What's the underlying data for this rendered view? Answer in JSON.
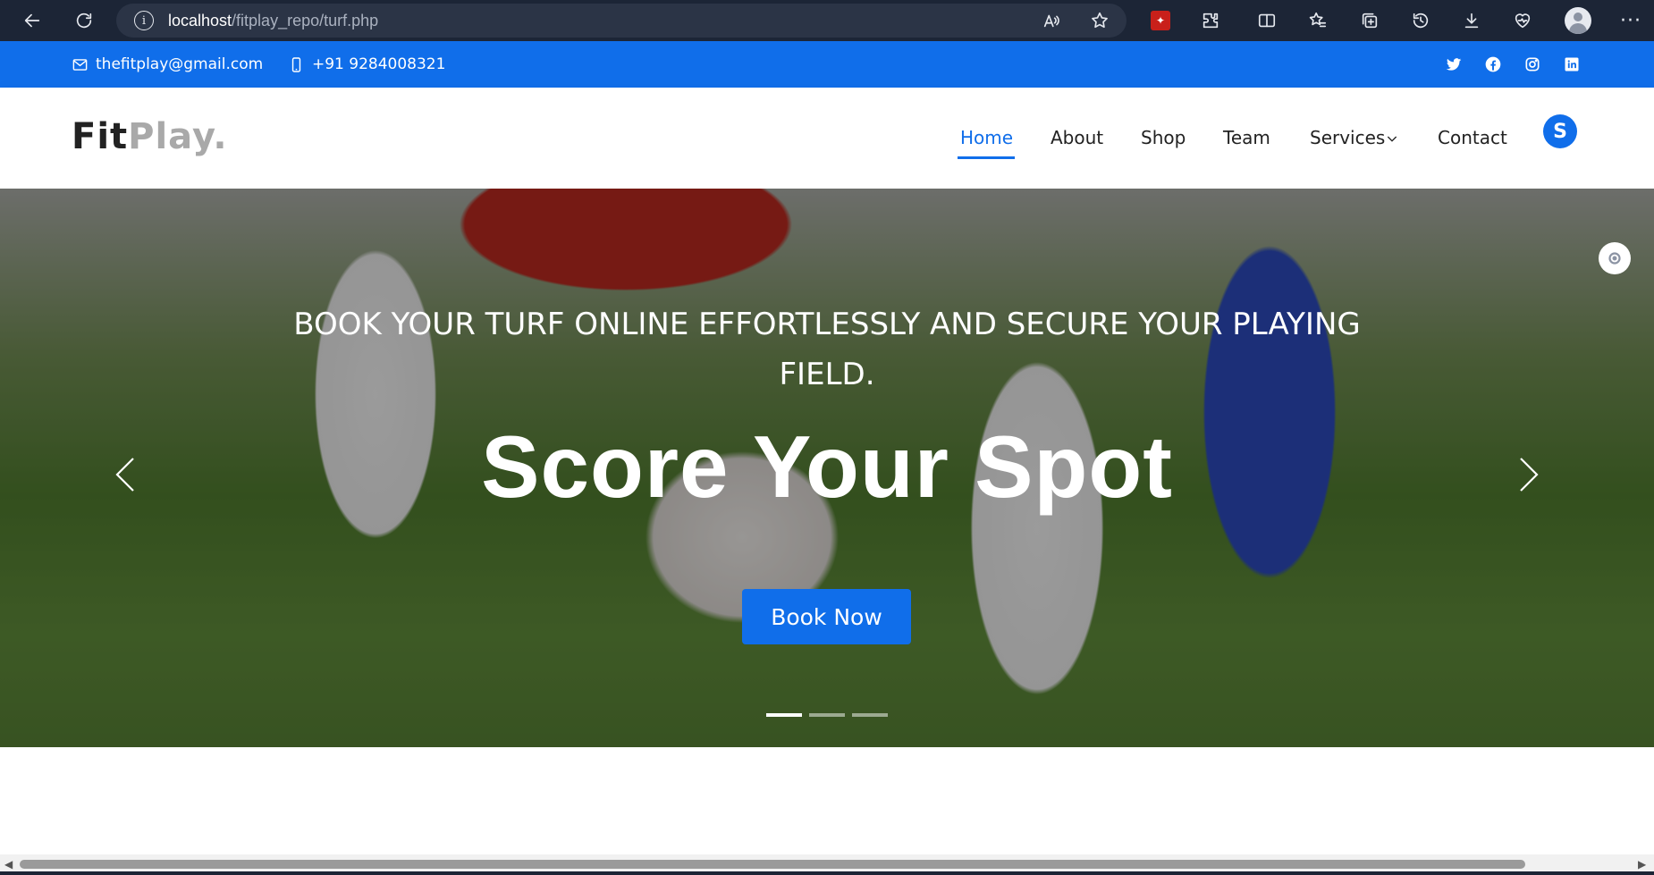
{
  "browser": {
    "url_host": "localhost",
    "url_path": "/fitplay_repo/turf.php"
  },
  "topbar": {
    "email": "thefitplay@gmail.com",
    "phone": "+91 9284008321",
    "social": [
      "twitter-icon",
      "facebook-icon",
      "instagram-icon",
      "linkedin-icon"
    ]
  },
  "header": {
    "logo_fit": "Fit",
    "logo_play": "Play.",
    "nav": {
      "home": "Home",
      "about": "About",
      "shop": "Shop",
      "team": "Team",
      "services": "Services",
      "contact": "Contact"
    },
    "avatar_letter": "S"
  },
  "hero": {
    "subtitle": "BOOK YOUR TURF ONLINE EFFORTLESSLY AND SECURE YOUR PLAYING FIELD.",
    "title": "Score Your Spot",
    "cta": "Book Now",
    "slides": 3,
    "active_slide": 1
  },
  "colors": {
    "brand": "#106eea",
    "browser_chrome": "#1c2536"
  }
}
